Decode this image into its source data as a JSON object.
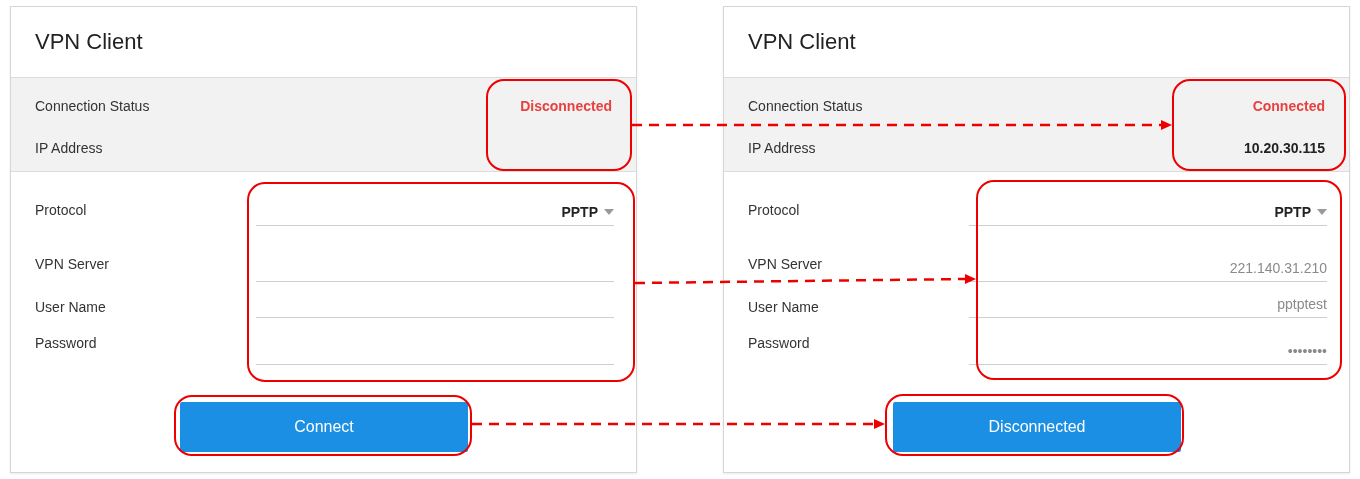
{
  "panels": [
    {
      "title": "VPN Client",
      "status_rows": [
        {
          "label": "Connection Status",
          "value": "Disconnected",
          "kind": "status"
        },
        {
          "label": "IP Address",
          "kind": "address"
        }
      ],
      "fields": [
        {
          "label": "Protocol",
          "value": "PPTP",
          "kind": "select"
        },
        {
          "label": "VPN Server",
          "kind": "text"
        },
        {
          "label": "User Name",
          "kind": "text"
        },
        {
          "label": "Password",
          "kind": "password"
        }
      ],
      "button": "Connect"
    },
    {
      "title": "VPN Client",
      "status_rows": [
        {
          "label": "Connection Status",
          "value": "Connected",
          "kind": "status"
        },
        {
          "label": "IP Address",
          "value": "10.20.30.115",
          "kind": "address"
        }
      ],
      "fields": [
        {
          "label": "Protocol",
          "value": "PPTP",
          "kind": "select"
        },
        {
          "label": "VPN Server",
          "value": "221.140.31.210",
          "kind": "text"
        },
        {
          "label": "User Name",
          "value": "pptptest",
          "kind": "text"
        },
        {
          "label": "Password",
          "value": "••••••••",
          "kind": "password"
        }
      ],
      "button": "Disconnected"
    }
  ]
}
